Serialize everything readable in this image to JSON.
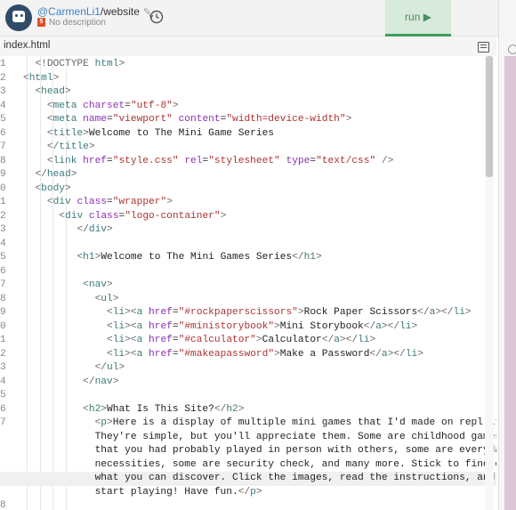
{
  "header": {
    "user": "@CarmenLi1",
    "repo_sep": "/website",
    "description": "No description",
    "run_label": "run ▶"
  },
  "tab": {
    "name": "index.html"
  },
  "editor": {
    "lines": [
      {
        "n": "1",
        "html": "<span class=\"g\">&lt;!DOCTYPE</span> <span class=\"t\">html</span><span class=\"g\">&gt;</span>",
        "indent": "  "
      },
      {
        "n": "2",
        "html": "<span class=\"g\">&lt;</span><span class=\"t\">html</span><span class=\"g\">&gt;</span>",
        "indent": ""
      },
      {
        "n": "3",
        "html": "<span class=\"g\">&lt;</span><span class=\"t\">head</span><span class=\"g\">&gt;</span>",
        "indent": "  "
      },
      {
        "n": "4",
        "html": "<span class=\"g\">&lt;</span><span class=\"t\">meta</span> <span class=\"a\">charset</span>=<span class=\"v\">\"utf-8\"</span><span class=\"g\">&gt;</span>",
        "indent": "    "
      },
      {
        "n": "5",
        "html": "<span class=\"g\">&lt;</span><span class=\"t\">meta</span> <span class=\"a\">name</span>=<span class=\"v\">\"viewport\"</span> <span class=\"a\">content</span>=<span class=\"v\">\"width=device-width\"</span><span class=\"g\">&gt;</span>",
        "indent": "    "
      },
      {
        "n": "6",
        "html": "<span class=\"g\">&lt;</span><span class=\"t\">title</span><span class=\"g\">&gt;</span>Welcome to The Mini Game Series",
        "indent": "    "
      },
      {
        "n": "7",
        "html": "<span class=\"g\">&lt;/</span><span class=\"t\">title</span><span class=\"g\">&gt;</span>",
        "indent": "    "
      },
      {
        "n": "8",
        "html": "<span class=\"g\">&lt;</span><span class=\"t\">link</span> <span class=\"a\">href</span>=<span class=\"v\">\"style.css\"</span> <span class=\"a\">rel</span>=<span class=\"v\">\"stylesheet\"</span> <span class=\"a\">type</span>=<span class=\"v\">\"text/css\"</span> <span class=\"g\">/&gt;</span>",
        "indent": "    "
      },
      {
        "n": "9",
        "html": "<span class=\"g\">&lt;/</span><span class=\"t\">head</span><span class=\"g\">&gt;</span>",
        "indent": "  "
      },
      {
        "n": "0",
        "html": "<span class=\"g\">&lt;</span><span class=\"t\">body</span><span class=\"g\">&gt;</span>",
        "indent": "  "
      },
      {
        "n": "1",
        "html": "<span class=\"g\">&lt;</span><span class=\"t\">div</span> <span class=\"a\">class</span>=<span class=\"v\">\"wrapper\"</span><span class=\"g\">&gt;</span>",
        "indent": "    "
      },
      {
        "n": "2",
        "html": "<span class=\"g\">&lt;</span><span class=\"t\">div</span> <span class=\"a\">class</span>=<span class=\"v\">\"logo-container\"</span><span class=\"g\">&gt;</span>",
        "indent": "      "
      },
      {
        "n": "3",
        "html": "<span class=\"g\">&lt;/</span><span class=\"t\">div</span><span class=\"g\">&gt;</span>",
        "indent": "         "
      },
      {
        "n": "4",
        "html": "",
        "indent": ""
      },
      {
        "n": "5",
        "html": "<span class=\"g\">&lt;</span><span class=\"t\">h1</span><span class=\"g\">&gt;</span>Welcome to The Mini Games Series<span class=\"g\">&lt;/</span><span class=\"t\">h1</span><span class=\"g\">&gt;</span>",
        "indent": "         "
      },
      {
        "n": "6",
        "html": "",
        "indent": ""
      },
      {
        "n": "7",
        "html": "<span class=\"g\">&lt;</span><span class=\"t\">nav</span><span class=\"g\">&gt;</span>",
        "indent": "          "
      },
      {
        "n": "8",
        "html": "<span class=\"g\">&lt;</span><span class=\"t\">ul</span><span class=\"g\">&gt;</span>",
        "indent": "            "
      },
      {
        "n": "9",
        "html": "<span class=\"g\">&lt;</span><span class=\"t\">li</span><span class=\"g\">&gt;&lt;</span><span class=\"t\">a</span> <span class=\"a\">href</span>=<span class=\"v\">\"#rockpaperscissors\"</span><span class=\"g\">&gt;</span>Rock Paper Scissors<span class=\"g\">&lt;/</span><span class=\"t\">a</span><span class=\"g\">&gt;&lt;/</span><span class=\"t\">li</span><span class=\"g\">&gt;</span>",
        "indent": "              "
      },
      {
        "n": "0",
        "html": "<span class=\"g\">&lt;</span><span class=\"t\">li</span><span class=\"g\">&gt;&lt;</span><span class=\"t\">a</span> <span class=\"a\">href</span>=<span class=\"v\">\"#ministorybook\"</span><span class=\"g\">&gt;</span>Mini Storybook<span class=\"g\">&lt;/</span><span class=\"t\">a</span><span class=\"g\">&gt;&lt;/</span><span class=\"t\">li</span><span class=\"g\">&gt;</span>",
        "indent": "              "
      },
      {
        "n": "1",
        "html": "<span class=\"g\">&lt;</span><span class=\"t\">li</span><span class=\"g\">&gt;&lt;</span><span class=\"t\">a</span> <span class=\"a\">href</span>=<span class=\"v\">\"#calculator\"</span><span class=\"g\">&gt;</span>Calculator<span class=\"g\">&lt;/</span><span class=\"t\">a</span><span class=\"g\">&gt;&lt;/</span><span class=\"t\">li</span><span class=\"g\">&gt;</span>",
        "indent": "              "
      },
      {
        "n": "2",
        "html": "<span class=\"g\">&lt;</span><span class=\"t\">li</span><span class=\"g\">&gt;&lt;</span><span class=\"t\">a</span> <span class=\"a\">href</span>=<span class=\"v\">\"#makeapassword\"</span><span class=\"g\">&gt;</span>Make a Password<span class=\"g\">&lt;/</span><span class=\"t\">a</span><span class=\"g\">&gt;&lt;/</span><span class=\"t\">li</span><span class=\"g\">&gt;</span>",
        "indent": "              "
      },
      {
        "n": "3",
        "html": "<span class=\"g\">&lt;/</span><span class=\"t\">ul</span><span class=\"g\">&gt;</span>",
        "indent": "            "
      },
      {
        "n": "4",
        "html": "<span class=\"g\">&lt;/</span><span class=\"t\">nav</span><span class=\"g\">&gt;</span>",
        "indent": "          "
      },
      {
        "n": "5",
        "html": "",
        "indent": ""
      },
      {
        "n": "6",
        "html": "<span class=\"g\">&lt;</span><span class=\"t\">h2</span><span class=\"g\">&gt;</span>What Is This Site?<span class=\"g\">&lt;/</span><span class=\"t\">h2</span><span class=\"g\">&gt;</span>",
        "indent": "          "
      },
      {
        "n": "7",
        "html": "<span class=\"g\">&lt;</span><span class=\"t\">p</span><span class=\"g\">&gt;</span>Here is a display of multiple mini games that I'd made on repl.it.",
        "indent": "            "
      },
      {
        "n": "",
        "html": "They're simple, but you'll appreciate them. Some are childhood games",
        "indent": "            "
      },
      {
        "n": "",
        "html": "that you had probably played in person with others, some are everyday",
        "indent": "            "
      },
      {
        "n": "",
        "html": "necessities, some are security check, and many more. Stick to find out",
        "indent": "            "
      },
      {
        "n": "",
        "html": "what you can discover. Click the images, read the instructions, and",
        "indent": "            ",
        "hl": true
      },
      {
        "n": "",
        "html": "start playing! Have fun.<span class=\"g\">&lt;/</span><span class=\"t\">p</span><span class=\"g\">&gt;</span>",
        "indent": "            "
      },
      {
        "n": "8",
        "html": "",
        "indent": ""
      }
    ]
  }
}
